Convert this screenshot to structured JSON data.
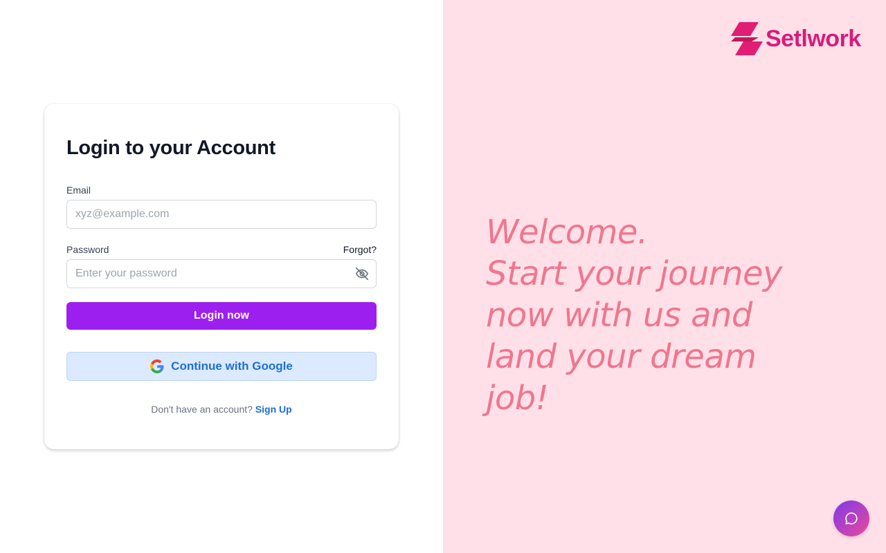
{
  "login": {
    "title": "Login to your Account",
    "email_label": "Email",
    "email_placeholder": "xyz@example.com",
    "email_value": "",
    "password_label": "Password",
    "forgot_label": "Forgot?",
    "password_placeholder": "Enter your password",
    "password_value": "",
    "password_toggle_icon": "eye-off-icon",
    "login_button": "Login now",
    "google_button": "Continue with Google",
    "google_icon": "google-icon",
    "signup_prompt": "Don't have an account?",
    "signup_link": "Sign Up"
  },
  "brand": {
    "name": "Setlwork",
    "logo_icon": "setlwork-logo-icon",
    "color": "#d81b7a"
  },
  "hero": {
    "lines": [
      "Welcome.",
      "Start your journey",
      "now with us and",
      "land your dream",
      "job!"
    ],
    "color": "#f0768f"
  },
  "chat": {
    "icon": "chat-bubble-icon"
  },
  "colors": {
    "primary": "#9d1ff0",
    "link": "#1d6ed8",
    "panel_background": "#ffe0e8"
  }
}
